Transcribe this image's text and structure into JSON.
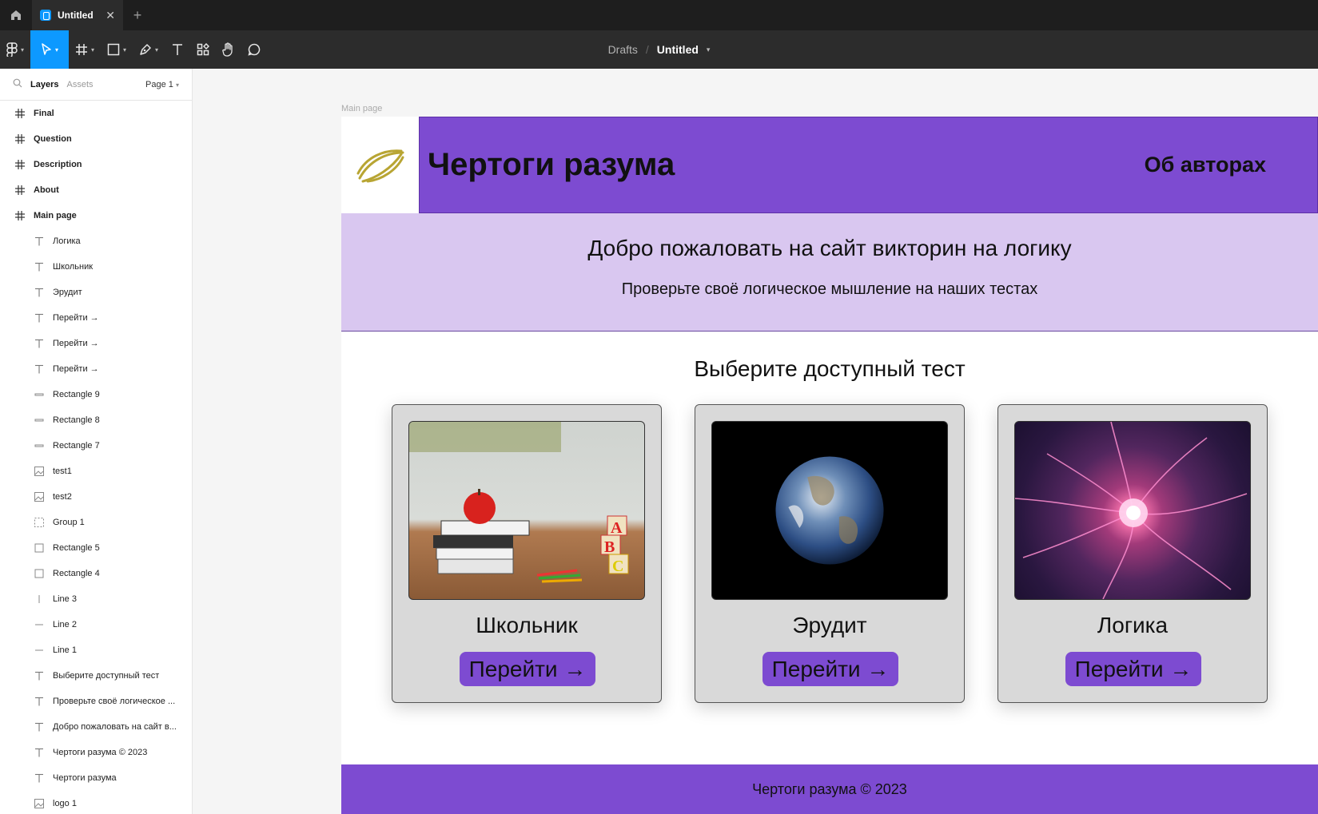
{
  "app": {
    "tab_title": "Untitled",
    "new_tab_symbol": "+",
    "close_symbol": "✕"
  },
  "toolbar": {
    "breadcrumb_parent": "Drafts",
    "breadcrumb_separator": "/",
    "file_name": "Untitled",
    "tools": [
      "figma-menu-icon",
      "move-tool-icon",
      "frame-tool-icon",
      "rectangle-tool-icon",
      "pen-tool-icon",
      "text-tool-icon",
      "resources-icon",
      "hand-tool-icon",
      "comment-icon"
    ],
    "accent_color": "#0d99ff"
  },
  "sidebar": {
    "tab_layers": "Layers",
    "tab_assets": "Assets",
    "page_selector": "Page 1",
    "frames": [
      "Final",
      "Question",
      "Description",
      "About",
      "Main page"
    ],
    "children": [
      {
        "icon": "text",
        "name": "Логика"
      },
      {
        "icon": "text",
        "name": "Школьник"
      },
      {
        "icon": "text",
        "name": "Эрудит"
      },
      {
        "icon": "text",
        "name": "Перейти →"
      },
      {
        "icon": "text",
        "name": "Перейти →"
      },
      {
        "icon": "text",
        "name": "Перейти →"
      },
      {
        "icon": "rect-line",
        "name": "Rectangle 9"
      },
      {
        "icon": "rect-line",
        "name": "Rectangle 8"
      },
      {
        "icon": "rect-line",
        "name": "Rectangle 7"
      },
      {
        "icon": "image",
        "name": "test1"
      },
      {
        "icon": "image",
        "name": "test2"
      },
      {
        "icon": "group",
        "name": "Group 1"
      },
      {
        "icon": "rectangle",
        "name": "Rectangle 5"
      },
      {
        "icon": "rectangle",
        "name": "Rectangle 4"
      },
      {
        "icon": "vline",
        "name": "Line 3"
      },
      {
        "icon": "hline",
        "name": "Line 2"
      },
      {
        "icon": "hline",
        "name": "Line 1"
      },
      {
        "icon": "text",
        "name": "Выберите доступный тест"
      },
      {
        "icon": "text",
        "name": "Проверьте своё логическое ..."
      },
      {
        "icon": "text",
        "name": "Добро пожаловать на сайт в..."
      },
      {
        "icon": "text",
        "name": "Чертоги разума © 2023"
      },
      {
        "icon": "text",
        "name": "Чертоги разума"
      },
      {
        "icon": "image",
        "name": "logo 1"
      }
    ]
  },
  "canvas": {
    "frame_label": "Main page",
    "site_title": "Чертоги разума",
    "nav_authors": "Об авторах",
    "hero_title": "Добро пожаловать на сайт викторин на логику",
    "hero_subtitle": "Проверьте своё логическое мышление на наших тестах",
    "choose_title": "Выберите доступный тест",
    "cards": [
      {
        "title": "Школьник",
        "button": "Перейти →"
      },
      {
        "title": "Эрудит",
        "button": "Перейти →"
      },
      {
        "title": "Логика",
        "button": "Перейти →"
      }
    ],
    "footer": "Чертоги разума © 2023",
    "brand_color": "#7d4bd1",
    "hero_color": "#d9c7f0"
  }
}
